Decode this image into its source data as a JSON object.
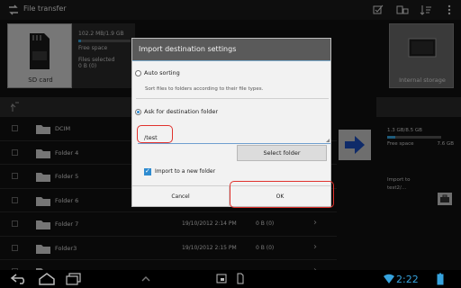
{
  "app": {
    "title": "File transfer"
  },
  "source": {
    "label": "SD card",
    "storage_text": "102.2 MB/1.9 GB",
    "storage_fraction": 0.05,
    "free_space_label": "Free space",
    "files_selected_label": "Files selected",
    "files_selected_value": "0 B (0)"
  },
  "files": [
    {
      "name": "DCIM",
      "date": "",
      "size": ""
    },
    {
      "name": "Folder 4",
      "date": "",
      "size": ""
    },
    {
      "name": "Folder 5",
      "date": "",
      "size": ""
    },
    {
      "name": "Folder 6",
      "date": "",
      "size": ""
    },
    {
      "name": "Folder 7",
      "date": "19/10/2012 2:14 PM",
      "size": "0 B (0)"
    },
    {
      "name": "Folder3",
      "date": "19/10/2012 2:15 PM",
      "size": "0 B (0)"
    },
    {
      "name": "",
      "date": "",
      "size": ""
    }
  ],
  "destination": {
    "label": "Internal storage",
    "storage_text": "1.3 GB/8.5 GB",
    "storage_fraction": 0.15,
    "free_space_label": "Free space",
    "free_space_value": "7.6 GB",
    "import_to_label": "Import to",
    "import_to_value": "test2/..."
  },
  "dialog": {
    "title": "Import destination settings",
    "auto_sorting_label": "Auto sorting",
    "auto_sorting_desc": "Sort files to folders according to their file types.",
    "ask_label": "Ask for destination folder",
    "folder_value": "/test",
    "select_folder_label": "Select folder",
    "import_new_label": "Import to a new folder",
    "import_new_checked": true,
    "selected_option": "ask",
    "cancel_label": "Cancel",
    "ok_label": "OK"
  },
  "statusbar": {
    "time": "2:22"
  },
  "colors": {
    "accent": "#36a3de",
    "highlight": "#e0322d",
    "arrow": "#1c4fc0"
  }
}
